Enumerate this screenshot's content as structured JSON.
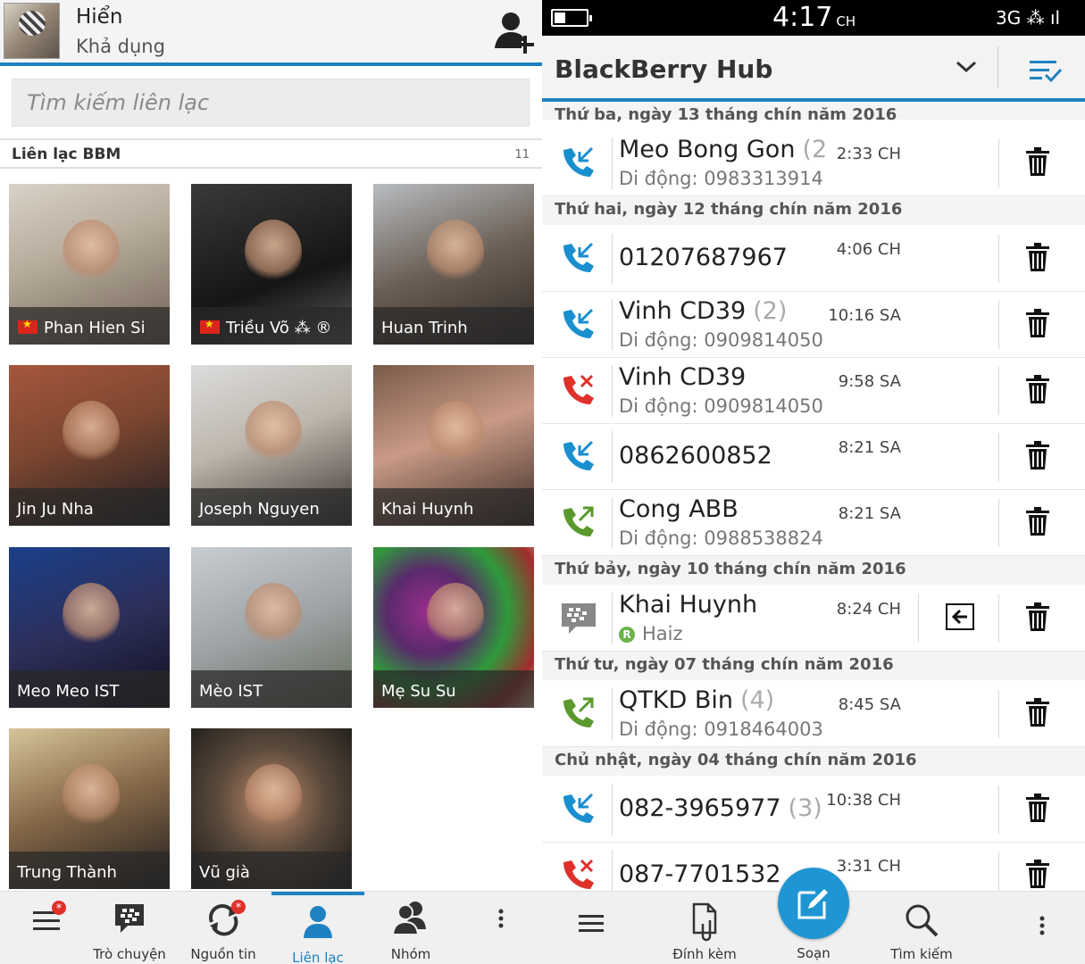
{
  "left": {
    "user": {
      "name": "Hiển",
      "status": "Khả dụng"
    },
    "search": {
      "placeholder": "Tìm kiếm liên lạc"
    },
    "section": {
      "title": "Liên lạc BBM",
      "count": "11"
    },
    "contacts": [
      {
        "name": "Phan Hien Si",
        "flag": true,
        "bg": "linear-gradient(160deg,#d9d2c7 0%,#b9ad9e 40%,#6f6254 100%)"
      },
      {
        "name": "Triều Võ ⁂ ®",
        "flag": true,
        "bg": "linear-gradient(160deg,#3a3a3a 0%,#151515 60%,#5c5c5c 100%)"
      },
      {
        "name": "Huan Trinh",
        "flag": false,
        "bg": "linear-gradient(160deg,#b8bcc0 0%,#6b5f55 50%,#2e2824 100%)"
      },
      {
        "name": "Jin Ju Nha",
        "flag": false,
        "bg": "linear-gradient(160deg,#a6573c 0%,#7c4630 45%,#1e1e22 100%)"
      },
      {
        "name": "Joseph Nguyen",
        "flag": false,
        "bg": "linear-gradient(160deg,#dcdcdc 0%,#bdb6ac 45%,#3b3530 100%)"
      },
      {
        "name": "Khai Huynh",
        "flag": false,
        "bg": "linear-gradient(160deg,#7a5a4a 0%,#c99a86 45%,#3a2a25 100%)"
      },
      {
        "name": "Meo Meo IST",
        "flag": false,
        "bg": "linear-gradient(160deg,#1a3f8a 0%,#2d2f5a 50%,#101020 100%)"
      },
      {
        "name": "Mèo IST",
        "flag": false,
        "bg": "linear-gradient(160deg,#c8cdd2 0%,#9ea3a6 50%,#5f6a55 100%)"
      },
      {
        "name": "Mẹ Su Su",
        "flag": false,
        "bg": "radial-gradient(circle at 35% 40%,#9b2f8c 0%,#5a2a6b 30%,#2f9a3c 55%,#a02b2b 80%,#d8c8a0 100%)"
      },
      {
        "name": "Trung Thành",
        "flag": false,
        "bg": "linear-gradient(160deg,#d6c59a 0%,#8a6b4a 45%,#1f1d1d 100%)"
      },
      {
        "name": "Vũ già",
        "flag": false,
        "bg": "radial-gradient(circle at 50% 45%,#c08a6a 0%,#5a4a3c 45%,#1a1816 100%)"
      }
    ],
    "tabs": [
      {
        "label": "",
        "icon": "menu-icon",
        "badge": true
      },
      {
        "label": "Trò chuyện",
        "icon": "chat-icon",
        "badge": false
      },
      {
        "label": "Nguồn tin",
        "icon": "updates-icon",
        "badge": true
      },
      {
        "label": "Liên lạc",
        "icon": "contact-icon",
        "badge": false,
        "active": true
      },
      {
        "label": "Nhóm",
        "icon": "group-icon",
        "badge": false
      },
      {
        "label": "",
        "icon": "more-icon",
        "badge": false
      }
    ]
  },
  "right": {
    "status": {
      "time": "4:17",
      "ampm": "CH",
      "network": "3G ⁂ ıl"
    },
    "hub": {
      "title": "BlackBerry Hub"
    },
    "groups": [
      {
        "date": "Thứ ba, ngày 13 tháng chín năm 2016",
        "items": [
          {
            "type": "incoming",
            "name": "Meo Bong Gon",
            "count": "(2",
            "sub": "Di động: 0983313914",
            "time": "2:33 CH"
          }
        ]
      },
      {
        "date": "Thứ hai, ngày 12 tháng chín năm 2016",
        "items": [
          {
            "type": "incoming",
            "name": "01207687967",
            "count": "",
            "sub": "",
            "time": "4:06 CH"
          },
          {
            "type": "incoming",
            "name": "Vinh CD39",
            "count": "(2)",
            "sub": "Di động: 0909814050",
            "time": "10:16 SA"
          },
          {
            "type": "missed",
            "name": "Vinh CD39",
            "count": "",
            "sub": "Di động: 0909814050",
            "time": "9:58 SA"
          },
          {
            "type": "incoming",
            "name": "0862600852",
            "count": "",
            "sub": "",
            "time": "8:21 SA"
          },
          {
            "type": "outgoing",
            "name": "Cong ABB",
            "count": "",
            "sub": "Di động: 0988538824",
            "time": "8:21 SA"
          }
        ]
      },
      {
        "date": "Thứ bảy, ngày 10 tháng chín năm 2016",
        "items": [
          {
            "type": "bbm",
            "name": "Khai Huynh",
            "count": "",
            "sub": "Haiz",
            "time": "8:24 CH"
          }
        ]
      },
      {
        "date": "Thứ tư, ngày 07 tháng chín năm 2016",
        "items": [
          {
            "type": "outgoing",
            "name": "QTKD Bin",
            "count": "(4)",
            "sub": "Di động: 0918464003",
            "time": "8:45 SA"
          }
        ]
      },
      {
        "date": "Chủ nhật, ngày 04 tháng chín năm 2016",
        "items": [
          {
            "type": "incoming",
            "name": "082-3965977",
            "count": "(3)",
            "sub": "",
            "time": "10:38 CH"
          },
          {
            "type": "missed",
            "name": "087-7701532",
            "count": "",
            "sub": "",
            "time": "3:31 CH"
          }
        ]
      }
    ],
    "toolbar": {
      "menu_label": "",
      "attach_label": "Đính kèm",
      "compose_label": "Soạn",
      "search_label": "Tìm kiếm",
      "more_label": ""
    },
    "colors": {
      "accent": "#1f82c0",
      "incoming": "#1a8fd0",
      "missed": "#e0302a",
      "outgoing": "#5a9a2c"
    }
  }
}
